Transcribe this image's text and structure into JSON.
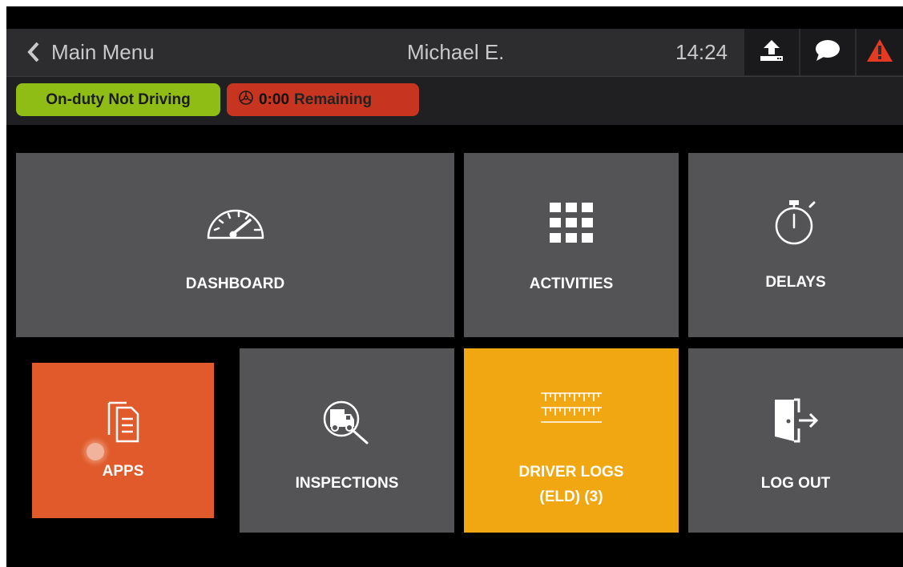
{
  "header": {
    "back_label": "Main Menu",
    "driver_name": "Michael E.",
    "time": "14:24"
  },
  "status": {
    "duty_status": "On-duty Not Driving",
    "remaining_time": "0:00",
    "remaining_label": "Remaining"
  },
  "tiles": {
    "dashboard": "DASHBOARD",
    "activities": "ACTIVITIES",
    "delays": "DELAYS",
    "apps": "APPS",
    "inspections": "INSPECTIONS",
    "driver_logs_line1": "DRIVER LOGS",
    "driver_logs_line2": "(ELD) (3)",
    "logout": "LOG OUT"
  },
  "icons": {
    "back": "chevron-left-icon",
    "upload": "upload-icon",
    "message": "chat-bubble-icon",
    "alert": "warning-triangle-icon",
    "steering": "steering-wheel-icon",
    "dashboard": "speedometer-icon",
    "activities": "grid-icon",
    "delays": "stopwatch-icon",
    "apps": "documents-icon",
    "inspections": "truck-search-icon",
    "driver_logs": "log-ruler-icon",
    "logout": "exit-door-icon"
  },
  "colors": {
    "duty_green": "#8fbd16",
    "remaining_red": "#c7341f",
    "apps_orange": "#e05a2b",
    "driver_logs_amber": "#f1a712",
    "alert_red": "#e53a22",
    "tile_gray": "#545457"
  }
}
